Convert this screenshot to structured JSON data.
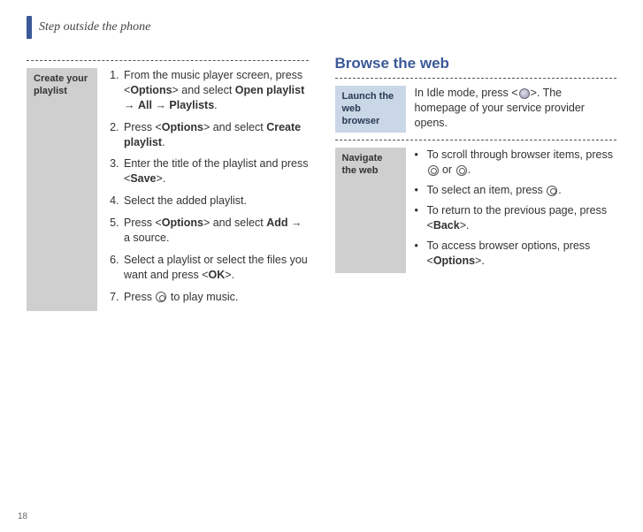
{
  "page": {
    "running_title": "Step outside the phone",
    "page_number": "18"
  },
  "left": {
    "sidehead": "Create your playlist",
    "steps": [
      {
        "pre": "From the music player screen, press <",
        "b1": "Options",
        "mid1": "> and select ",
        "b2": "Open playlist",
        "arrow1": " → ",
        "b3": "All",
        "arrow2": " → ",
        "b4": "Playlists",
        "post": "."
      },
      {
        "pre": "Press <",
        "b1": "Options",
        "mid1": "> and select ",
        "b2": "Create playlist",
        "post": "."
      },
      {
        "pre": "Enter the title of the playlist and press <",
        "b1": "Save",
        "post": ">."
      },
      {
        "pre": "Select the added playlist.",
        "plain": true
      },
      {
        "pre": "Press <",
        "b1": "Options",
        "mid1": "> and select ",
        "b2": "Add",
        "post": " → a source."
      },
      {
        "pre": "Select a playlist or select the files you want and press <",
        "b1": "OK",
        "post": ">."
      },
      {
        "pre": "Press ",
        "icon": "ring",
        "post": " to play music."
      }
    ]
  },
  "right": {
    "heading": "Browse the web",
    "launch": {
      "sidehead": "Launch the web browser",
      "text_pre": "In Idle mode, press <",
      "text_post": ">. The homepage of your service provider opens."
    },
    "navigate": {
      "sidehead": "Navigate the web",
      "bullets": [
        {
          "pre": "To scroll through browser items, press ",
          "icon1": "ring",
          "mid": " or ",
          "icon2": "ring",
          "post": "."
        },
        {
          "pre": "To select an item, press ",
          "icon1": "ring",
          "post": "."
        },
        {
          "pre": "To return to the previous page, press <",
          "b1": "Back",
          "post": ">."
        },
        {
          "pre": "To access browser options, press <",
          "b1": "Options",
          "post": ">."
        }
      ]
    }
  }
}
